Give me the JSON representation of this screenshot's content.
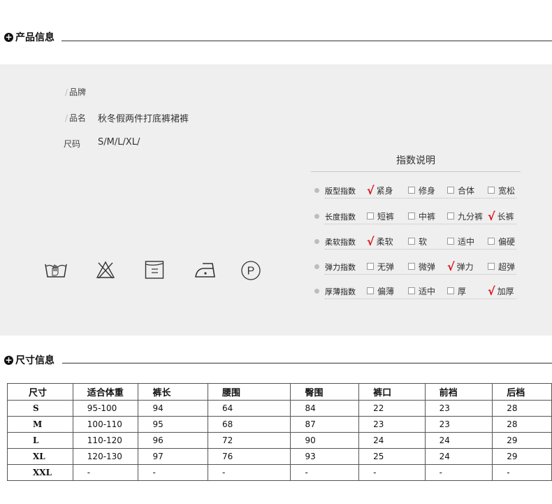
{
  "product_section": {
    "title": "产品信息"
  },
  "size_section": {
    "title": "尺寸信息"
  },
  "props": [
    {
      "label": "品牌",
      "value": ""
    },
    {
      "label": "品名",
      "value": "秋冬假两件打底裤裙裤"
    },
    {
      "label": "尺码",
      "value": "S/M/L/XL/"
    }
  ],
  "care_icons": [
    "hand-wash-icon",
    "no-bleach-icon",
    "line-dry-icon",
    "iron-icon",
    "dry-clean-p-icon"
  ],
  "care_symbol_p": "P",
  "index_panel": {
    "title": "指数说明",
    "rows": [
      {
        "name": "版型指数",
        "options": [
          {
            "label": "紧身",
            "checked": true
          },
          {
            "label": "修身",
            "checked": false
          },
          {
            "label": "合体",
            "checked": false
          },
          {
            "label": "宽松",
            "checked": false
          }
        ]
      },
      {
        "name": "长度指数",
        "options": [
          {
            "label": "短裤",
            "checked": false
          },
          {
            "label": "中裤",
            "checked": false
          },
          {
            "label": "九分裤",
            "checked": false
          },
          {
            "label": "长裤",
            "checked": true
          }
        ]
      },
      {
        "name": "柔软指数",
        "options": [
          {
            "label": "柔软",
            "checked": true
          },
          {
            "label": "软",
            "checked": false
          },
          {
            "label": "适中",
            "checked": false
          },
          {
            "label": "偏硬",
            "checked": false
          }
        ]
      },
      {
        "name": "弹力指数",
        "options": [
          {
            "label": "无弹",
            "checked": false
          },
          {
            "label": "微弹",
            "checked": false
          },
          {
            "label": "弹力",
            "checked": true
          },
          {
            "label": "超弹",
            "checked": false
          }
        ]
      },
      {
        "name": "厚薄指数",
        "options": [
          {
            "label": "偏薄",
            "checked": false
          },
          {
            "label": "适中",
            "checked": false
          },
          {
            "label": "厚",
            "checked": false
          },
          {
            "label": "加厚",
            "checked": true
          }
        ]
      }
    ]
  },
  "size_table": {
    "headers": [
      "尺寸",
      "适合体重",
      "裤长",
      "腰围",
      "臀围",
      "裤口",
      "前裆",
      "后档"
    ],
    "rows": [
      [
        "S",
        "95-100",
        "94",
        "64",
        "84",
        "22",
        "23",
        "28"
      ],
      [
        "M",
        "100-110",
        "95",
        "68",
        "87",
        "23",
        "23",
        "28"
      ],
      [
        "L",
        "110-120",
        "96",
        "72",
        "90",
        "24",
        "24",
        "29"
      ],
      [
        "XL",
        "120-130",
        "97",
        "76",
        "93",
        "25",
        "24",
        "29"
      ],
      [
        "XXL",
        "-",
        "-",
        "-",
        "-",
        "-",
        "-",
        "-"
      ]
    ]
  },
  "colors": {
    "panel_bg": "#efefef",
    "check_red": "#d8121b"
  }
}
